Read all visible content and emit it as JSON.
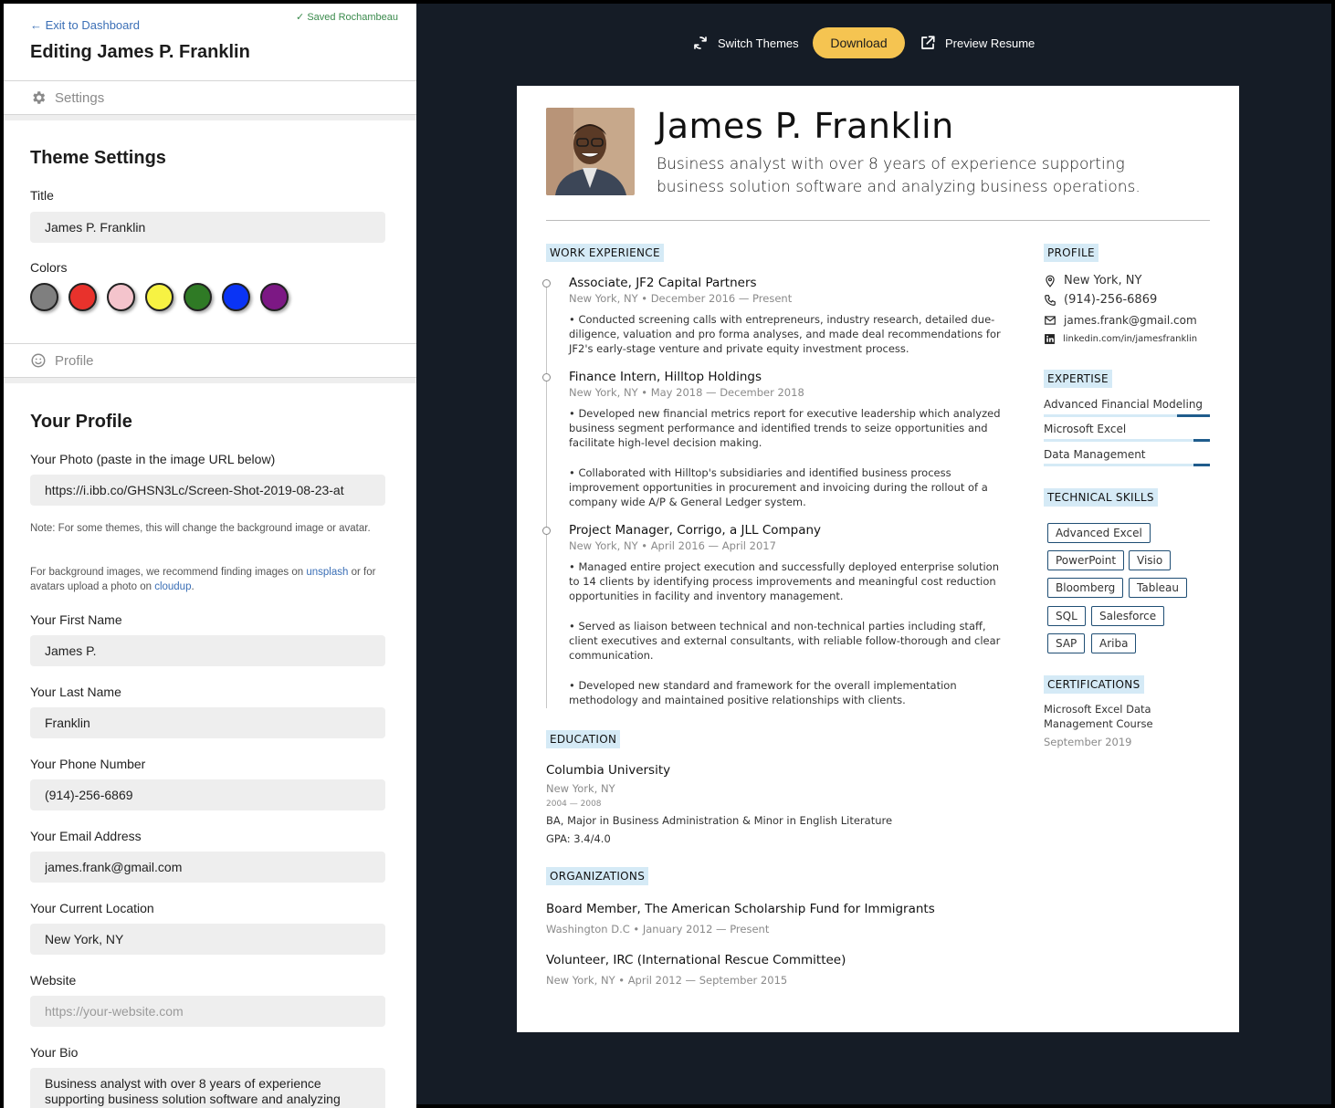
{
  "editor": {
    "exit_link": "← Exit to Dashboard",
    "saved_status": "✓ Saved Rochambeau",
    "editing_title": "Editing James P. Franklin",
    "settings_header": "Settings",
    "theme_settings_title": "Theme Settings",
    "title_label": "Title",
    "title_value": "James P. Franklin",
    "colors_label": "Colors",
    "colors": [
      "#7f7f7f",
      "#e8322c",
      "#f4c4cc",
      "#f7f243",
      "#2f7a25",
      "#0a34f5",
      "#7c1884"
    ],
    "profile_header": "Profile",
    "your_profile_title": "Your Profile",
    "photo_label": "Your Photo (paste in the image URL below)",
    "photo_value": "https://i.ibb.co/GHSN3Lc/Screen-Shot-2019-08-23-at",
    "note_1": "Note: For some themes, this will change the background image or avatar.",
    "note_2_prefix": "For background images, we recommend finding images on ",
    "note_2_link1": "unsplash",
    "note_2_middle": " or for avatars upload a photo on ",
    "note_2_link2": "cloudup",
    "note_2_suffix": ".",
    "first_name_label": "Your First Name",
    "first_name_value": "James P.",
    "last_name_label": "Your Last Name",
    "last_name_value": "Franklin",
    "phone_label": "Your Phone Number",
    "phone_value": "(914)-256-6869",
    "email_label": "Your Email Address",
    "email_value": "james.frank@gmail.com",
    "location_label": "Your Current Location",
    "location_value": "New York, NY",
    "website_label": "Website",
    "website_placeholder": "https://your-website.com",
    "bio_label": "Your Bio",
    "bio_value": "Business analyst with over 8 years of experience supporting business solution software and analyzing"
  },
  "toolbar": {
    "switch_themes": "Switch Themes",
    "download": "Download",
    "preview_resume": "Preview Resume"
  },
  "resume": {
    "name": "James P. Franklin",
    "summary": "Business analyst with over 8 years of experience supporting business solution software and analyzing business operations.",
    "work_heading": "WORK EXPERIENCE",
    "jobs": [
      {
        "title": "Associate, JF2 Capital Partners",
        "meta": "New York, NY • December 2016 — Present",
        "bullets": [
          "• Conducted screening calls with entrepreneurs, industry research, detailed due-diligence, valuation and pro forma analyses, and made deal recommendations for JF2's early-stage venture and private equity investment process."
        ]
      },
      {
        "title": "Finance Intern, Hilltop Holdings",
        "meta": "New York, NY • May 2018 — December 2018",
        "bullets": [
          "• Developed new financial metrics report for executive leadership which analyzed business segment performance and identified trends to seize opportunities and facilitate high-level decision making.",
          "• Collaborated with Hilltop's subsidiaries and identified business process improvement opportunities in procurement and invoicing during the rollout of a company wide A/P & General Ledger system."
        ]
      },
      {
        "title": "Project Manager, Corrigo, a JLL Company",
        "meta": "New York, NY • April 2016 — April 2017",
        "bullets": [
          "• Managed entire project execution and successfully deployed enterprise solution to 14 clients by identifying process improvements and meaningful cost reduction opportunities in facility and inventory management.",
          "• Served as liaison between technical and non-technical parties including staff, client executives and external consultants, with reliable follow-thorough and clear communication.",
          "• Developed new standard and framework for the overall implementation methodology and maintained positive relationships with clients."
        ]
      }
    ],
    "education_heading": "EDUCATION",
    "education": {
      "school": "Columbia University",
      "location": "New York, NY",
      "dates": "2004 — 2008",
      "degree": "BA, Major in Business Administration & Minor in English Literature",
      "gpa": "GPA: 3.4/4.0"
    },
    "organizations_heading": "ORGANIZATIONS",
    "organizations": [
      {
        "title": "Board Member, The American Scholarship Fund for Immigrants",
        "meta": "Washington D.C • January 2012 — Present"
      },
      {
        "title": "Volunteer, IRC (International Rescue Committee)",
        "meta": "New York, NY • April 2012 — September 2015"
      }
    ],
    "profile_heading": "PROFILE",
    "profile": {
      "location": "New York, NY",
      "phone": "(914)-256-6869",
      "email": "james.frank@gmail.com",
      "linkedin": "linkedin.com/in/jamesfranklin"
    },
    "expertise_heading": "EXPERTISE",
    "expertise": [
      {
        "name": "Advanced Financial Modeling",
        "level": 0.8
      },
      {
        "name": "Microsoft Excel",
        "level": 0.9
      },
      {
        "name": "Data Management",
        "level": 0.9
      }
    ],
    "technical_heading": "TECHNICAL SKILLS",
    "technical_skills": [
      "Advanced Excel",
      "PowerPoint",
      "Visio",
      "Bloomberg",
      "Tableau",
      "SQL",
      "Salesforce",
      "SAP",
      "Ariba"
    ],
    "certifications_heading": "CERTIFICATIONS",
    "certification": {
      "name": "Microsoft Excel Data Management Course",
      "date": "September 2019"
    }
  },
  "colors": {
    "preview_bg": "#151c26",
    "download_button": "#f5c451",
    "badge_bg": "#d5eaf6",
    "skill_fill": "#1f5c8c",
    "link": "#3b6fb6",
    "saved_green": "#3a8a4c"
  }
}
